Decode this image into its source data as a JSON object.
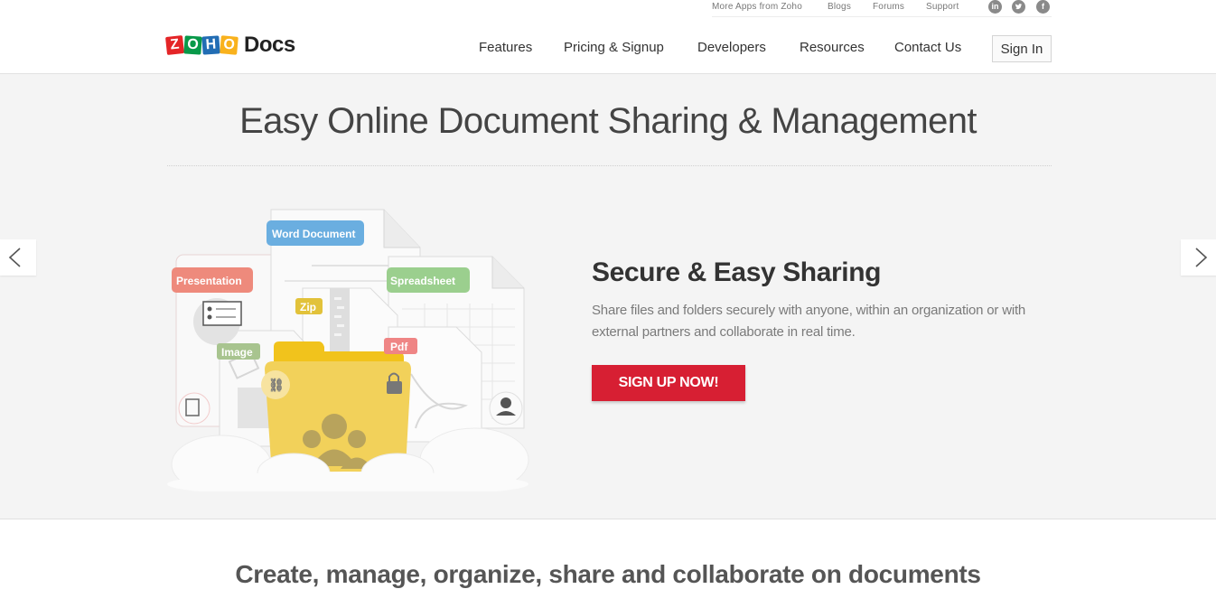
{
  "header": {
    "top_links": [
      "More Apps from Zoho",
      "Blogs",
      "Forums",
      "Support"
    ],
    "social_icons": [
      "linkedin-icon",
      "twitter-icon",
      "facebook-icon"
    ],
    "logo": {
      "letters": [
        "Z",
        "O",
        "H",
        "O"
      ],
      "letter_colors": [
        "#e42527",
        "#089949",
        "#226db4",
        "#f9b21d"
      ],
      "product": "Docs"
    },
    "nav": [
      "Features",
      "Pricing & Signup",
      "Developers",
      "Resources",
      "Contact Us"
    ],
    "signin_label": "Sign In"
  },
  "hero": {
    "title": "Easy Online Document Sharing & Management",
    "slide": {
      "title": "Secure & Easy Sharing",
      "text": "Share files and folders securely with anyone, within an organization or with external partners and collaborate in real time.",
      "cta_label": "SIGN UP NOW!",
      "cta_color": "#d71f33"
    },
    "illustration_tags": [
      {
        "label": "Word Document",
        "color": "#6aaee0"
      },
      {
        "label": "Presentation",
        "color": "#ee8a7c"
      },
      {
        "label": "Spreadsheet",
        "color": "#9bcf8e"
      },
      {
        "label": "Zip",
        "color": "#e2c23a"
      },
      {
        "label": "Image",
        "color": "#a8c48f"
      },
      {
        "label": "Pdf",
        "color": "#ef8585"
      }
    ],
    "prev_icon": "chevron-left-icon",
    "next_icon": "chevron-right-icon"
  },
  "section": {
    "title": "Create, manage, organize, share and collaborate on documents"
  }
}
